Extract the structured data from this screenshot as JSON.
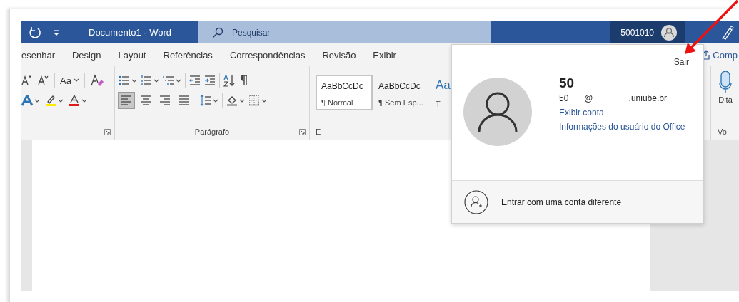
{
  "title_bar": {
    "title": "Documento1 - Word",
    "search": {
      "placeholder": "Pesquisar"
    },
    "account": {
      "name": "5001010"
    }
  },
  "tabs": [
    {
      "label": "esenhar",
      "selected": false
    },
    {
      "label": "Design",
      "selected": false
    },
    {
      "label": "Layout",
      "selected": false
    },
    {
      "label": "Referências",
      "selected": false
    },
    {
      "label": "Correspondências",
      "selected": false
    },
    {
      "label": "Revisão",
      "selected": false
    },
    {
      "label": "Exibir",
      "selected": false
    }
  ],
  "share_button": {
    "label": "Comp"
  },
  "ribbon": {
    "font_group": {
      "case_button": "Aa"
    },
    "paragraph_group": {
      "label": "Parágrafo",
      "alignments": [
        {
          "selected": true
        },
        {
          "selected": false
        },
        {
          "selected": false
        },
        {
          "selected": false
        }
      ]
    },
    "styles_group": {
      "label": "E",
      "styles": [
        {
          "sample": "AaBbCcDc",
          "name": "¶ Normal",
          "selected": true
        },
        {
          "sample": "AaBbCcDc",
          "name": "¶ Sem Esp...",
          "selected": false
        },
        {
          "sample": "Aa",
          "name": "T",
          "selected": false,
          "kind": "heading"
        }
      ]
    },
    "voice_group": {
      "button": "Dita",
      "label": "Vo"
    }
  },
  "account_menu": {
    "sign_out": "Sair",
    "display_name": "50",
    "email_parts": [
      "50",
      "@",
      ".uniube.br"
    ],
    "links": [
      "Exibir conta",
      "Informações do usuário do Office"
    ],
    "switch_account": "Entrar com uma conta diferente"
  }
}
